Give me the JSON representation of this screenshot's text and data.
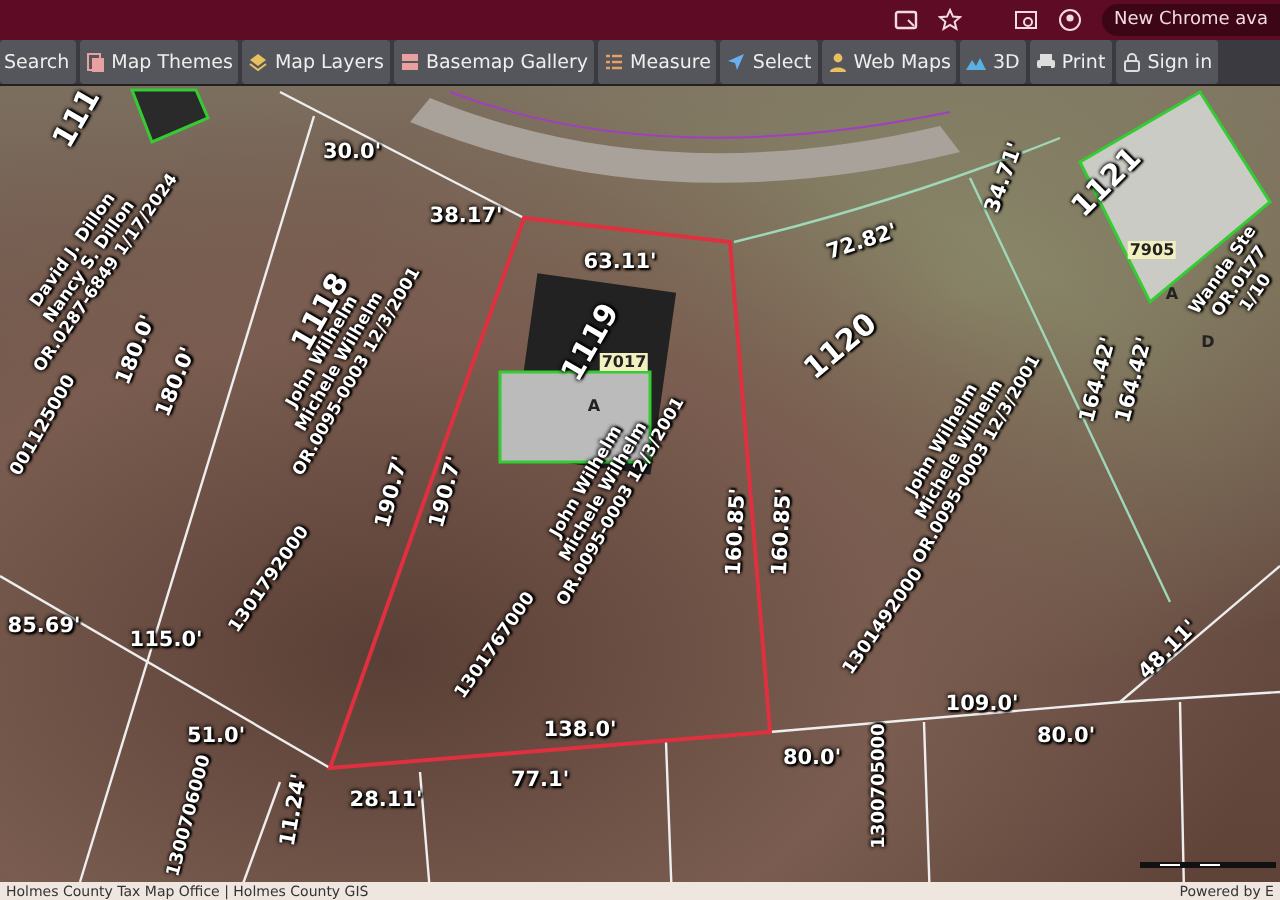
{
  "browser_bar": {
    "notice": "New Chrome ava"
  },
  "toolbar": {
    "buttons": [
      {
        "label": "Search"
      },
      {
        "label": "Map Themes"
      },
      {
        "label": "Map Layers"
      },
      {
        "label": "Basemap Gallery"
      },
      {
        "label": "Measure"
      },
      {
        "label": "Select"
      },
      {
        "label": "Web Maps"
      },
      {
        "label": "3D"
      },
      {
        "label": "Print"
      },
      {
        "label": "Sign in"
      }
    ]
  },
  "map": {
    "labels": [
      {
        "kind": "parcel",
        "text": "1118"
      },
      {
        "kind": "parcel",
        "text": "1119"
      },
      {
        "kind": "parcel",
        "text": "1120"
      },
      {
        "kind": "parcel",
        "text": "1121"
      },
      {
        "kind": "parcel",
        "text": "111"
      },
      {
        "kind": "owner",
        "lines": [
          "David J. Dillon",
          "Nancy S. Dillon",
          "OR.0287-6849  1/17/2024"
        ]
      },
      {
        "kind": "owner",
        "lines": [
          "John Wilhelm",
          "Michele Wilhelm",
          "OR.0095-0003  12/3/2001"
        ]
      },
      {
        "kind": "owner",
        "lines": [
          "John Wilhelm",
          "Michele Wilhelm",
          "OR.0095-0003  12/3/2001"
        ]
      },
      {
        "kind": "owner",
        "lines": [
          "John Wilhelm",
          "Michele Wilhelm",
          "OR.0095-0003  12/3/2001"
        ]
      },
      {
        "kind": "owner",
        "lines": [
          "Wanda Ste",
          "OR.0177",
          "1/10"
        ]
      },
      {
        "kind": "dimension",
        "text": "30.0'"
      },
      {
        "kind": "dimension",
        "text": "38.17'"
      },
      {
        "kind": "dimension",
        "text": "63.11'"
      },
      {
        "kind": "dimension",
        "text": "72.82'"
      },
      {
        "kind": "dimension",
        "text": "34.71'"
      },
      {
        "kind": "dimension",
        "text": "180.0'"
      },
      {
        "kind": "dimension",
        "text": "180.0'"
      },
      {
        "kind": "dimension",
        "text": "190.7'"
      },
      {
        "kind": "dimension",
        "text": "190.7'"
      },
      {
        "kind": "dimension",
        "text": "160.85'"
      },
      {
        "kind": "dimension",
        "text": "160.85'"
      },
      {
        "kind": "dimension",
        "text": "164.42'"
      },
      {
        "kind": "dimension",
        "text": "164.42'"
      },
      {
        "kind": "dimension",
        "text": "85.69'"
      },
      {
        "kind": "dimension",
        "text": "115.0'"
      },
      {
        "kind": "dimension",
        "text": "51.0'"
      },
      {
        "kind": "dimension",
        "text": "138.0'"
      },
      {
        "kind": "dimension",
        "text": "77.1'"
      },
      {
        "kind": "dimension",
        "text": "28.11'"
      },
      {
        "kind": "dimension",
        "text": "109.0'"
      },
      {
        "kind": "dimension",
        "text": "80.0'"
      },
      {
        "kind": "dimension",
        "text": "80.0'"
      },
      {
        "kind": "dimension",
        "text": "48.11'"
      },
      {
        "kind": "dimension",
        "text": "11.24'"
      },
      {
        "kind": "parcel_id",
        "text": "1301792000"
      },
      {
        "kind": "parcel_id",
        "text": "1301767000"
      },
      {
        "kind": "parcel_id",
        "text": "1301492000"
      },
      {
        "kind": "parcel_id",
        "text": "1300705000"
      },
      {
        "kind": "parcel_id",
        "text": "1300706000"
      },
      {
        "kind": "parcel_id",
        "text": "001125000"
      },
      {
        "kind": "building",
        "text": "7905"
      },
      {
        "kind": "building",
        "text": "7017"
      },
      {
        "kind": "building",
        "text": "A"
      },
      {
        "kind": "building",
        "text": "A"
      },
      {
        "kind": "building",
        "text": "D"
      }
    ]
  },
  "attribution": {
    "sources": "Holmes County Tax Map Office | Holmes County GIS",
    "powered": "Powered by E"
  }
}
